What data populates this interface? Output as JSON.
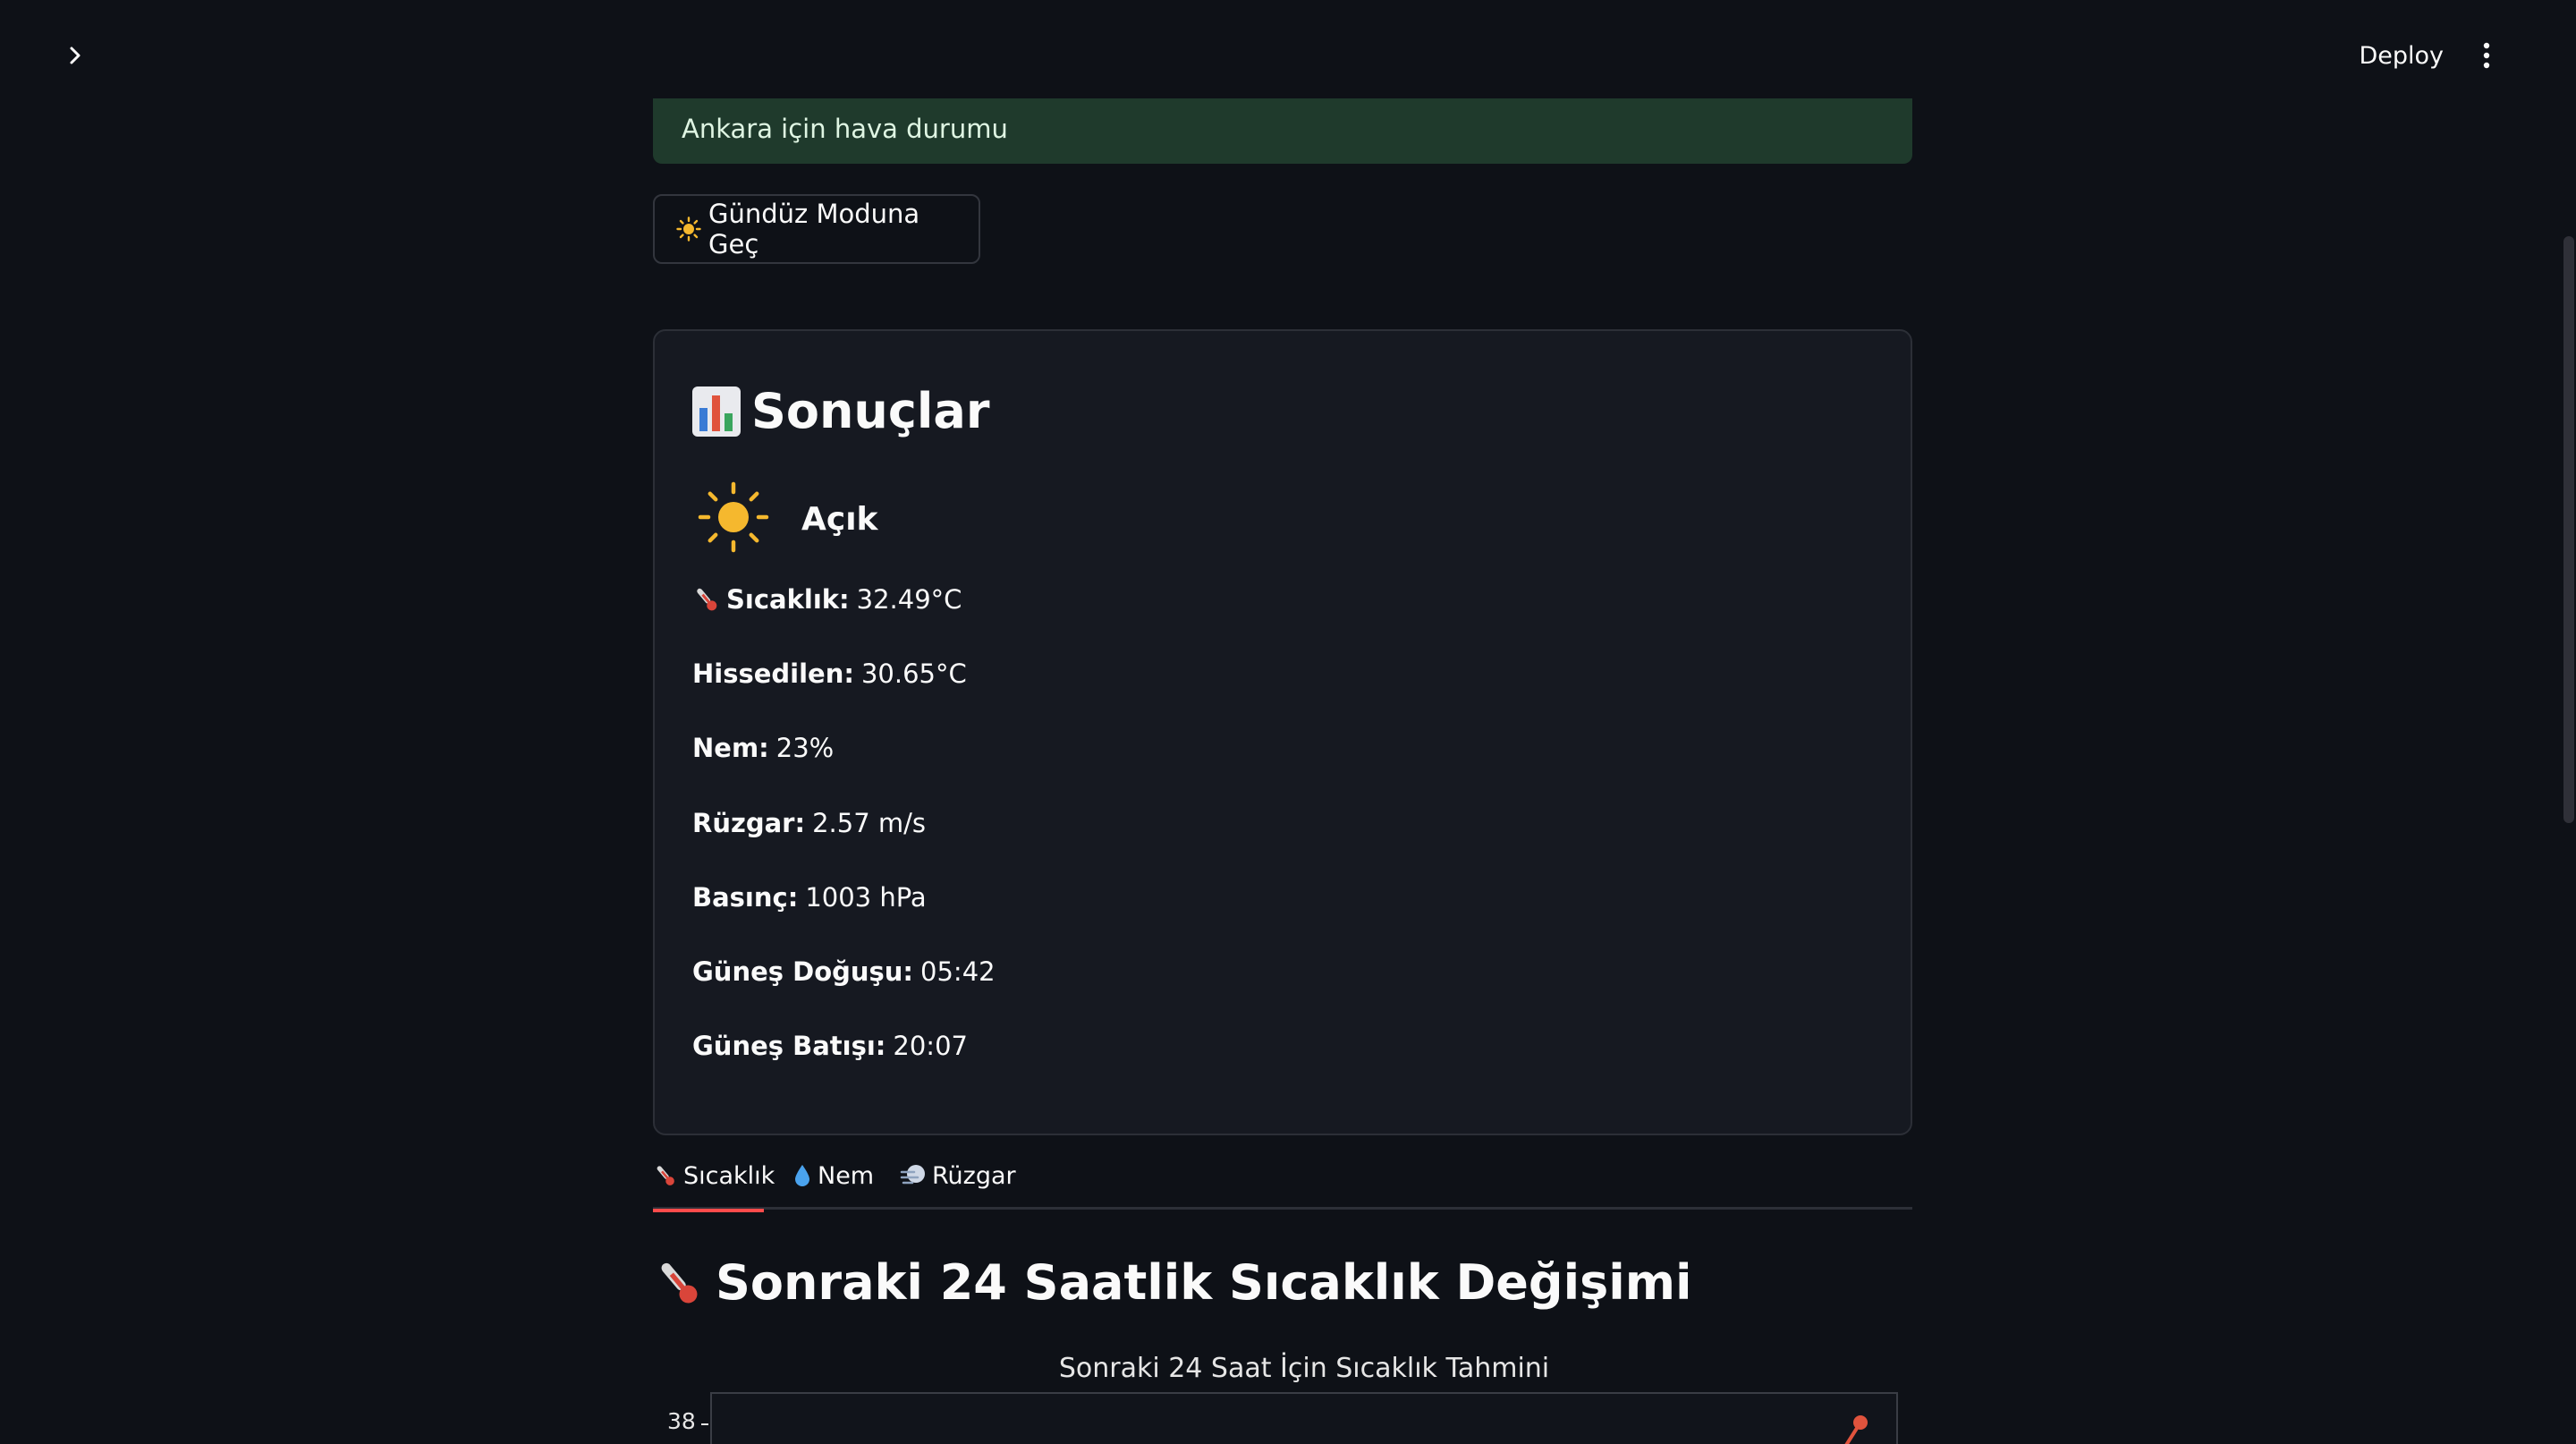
{
  "header": {
    "deploy_label": "Deploy"
  },
  "success": {
    "text": "Ankara için hava durumu"
  },
  "mode_button": {
    "label": "Gündüz Moduna Geç",
    "icon": "sun-icon"
  },
  "results": {
    "title": "Sonuçlar",
    "icon": "bar-chart-icon",
    "condition": "Açık",
    "condition_icon": "sun-icon",
    "metrics": [
      {
        "label": "Sıcaklık:",
        "value": "32.49°C",
        "icon": "thermometer-icon"
      },
      {
        "label": "Hissedilen:",
        "value": "30.65°C"
      },
      {
        "label": "Nem:",
        "value": "23%"
      },
      {
        "label": "Rüzgar:",
        "value": "2.57 m/s"
      },
      {
        "label": "Basınç:",
        "value": "1003 hPa"
      },
      {
        "label": "Güneş Doğuşu:",
        "value": "05:42"
      },
      {
        "label": "Güneş Batışı:",
        "value": "20:07"
      }
    ]
  },
  "tabs": [
    {
      "label": "Sıcaklık",
      "icon": "thermometer-icon",
      "active": true
    },
    {
      "label": "Nem",
      "icon": "droplet-icon",
      "active": false
    },
    {
      "label": "Rüzgar",
      "icon": "wind-icon",
      "active": false
    }
  ],
  "section": {
    "title": "Sonraki 24 Saatlik Sıcaklık Değişimi",
    "icon": "thermometer-icon"
  },
  "chart_data": {
    "type": "line",
    "title": "Sonraki 24 Saat İçin Sıcaklık Tahmini",
    "xlabel": "",
    "ylabel": "",
    "y_tick_labels": [
      "38"
    ],
    "series": [
      {
        "color": "#e0533d",
        "values": [
          38
        ]
      }
    ]
  },
  "colors": {
    "background": "#0e1117",
    "success_bg": "#1f3a2c",
    "accent": "#ff4b4b",
    "line": "#e0533d"
  }
}
